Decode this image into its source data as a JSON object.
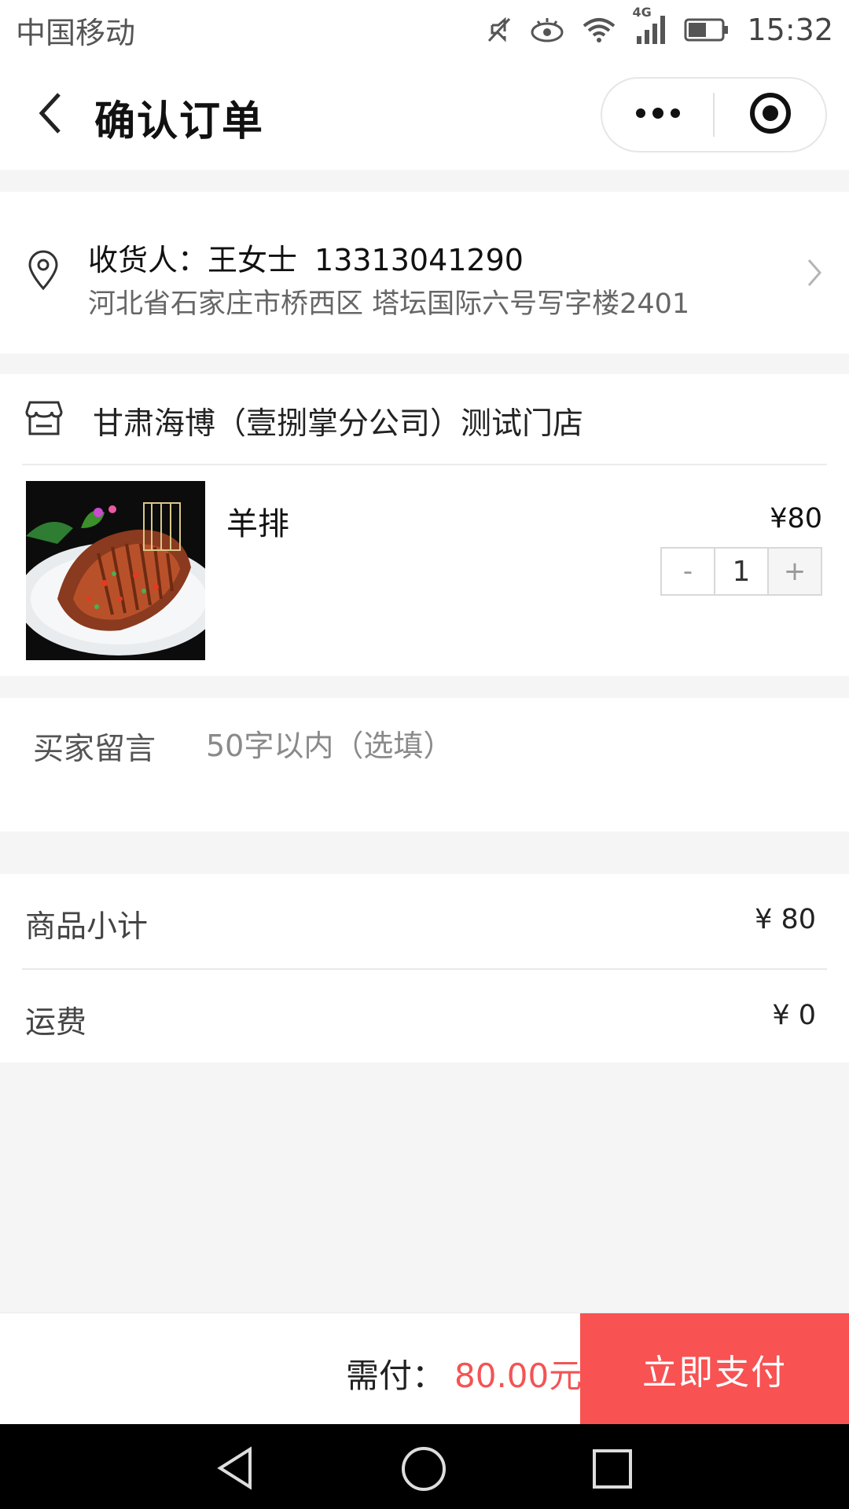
{
  "status_bar": {
    "carrier": "中国移动",
    "network": "4G",
    "time": "15:32"
  },
  "navbar": {
    "title": "确认订单",
    "icons": [
      "back-arrow-icon",
      "more-dots-icon",
      "target-circle-icon"
    ]
  },
  "address": {
    "receiver_label": "收货人：王女士",
    "phone": "13313041290",
    "address": "河北省石家庄市桥西区 塔坛国际六号写字楼2401",
    "icons": [
      "location-pin-icon",
      "chevron-right-icon"
    ]
  },
  "store": {
    "name": "甘肃海博（壹捌掌分公司）测试门店",
    "icon": "store-icon"
  },
  "product": {
    "name": "羊排",
    "price": "¥80",
    "quantity": "1",
    "minus_label": "-",
    "plus_label": "+"
  },
  "message": {
    "label": "买家留言",
    "placeholder": "50字以内（选填）"
  },
  "summary": {
    "subtotal_label": "商品小计",
    "subtotal_value": "¥ 80",
    "shipping_label": "运费",
    "shipping_value": "¥ 0"
  },
  "paybar": {
    "due_label": "需付：",
    "due_amount": "80.00元",
    "pay_button": "立即支付"
  },
  "colors": {
    "accent": "#f85253",
    "price_text": "#f35455",
    "background": "#f5f5f5"
  },
  "system_nav": {
    "icons": [
      "triangle-back-icon",
      "circle-home-icon",
      "square-recent-icon"
    ]
  }
}
